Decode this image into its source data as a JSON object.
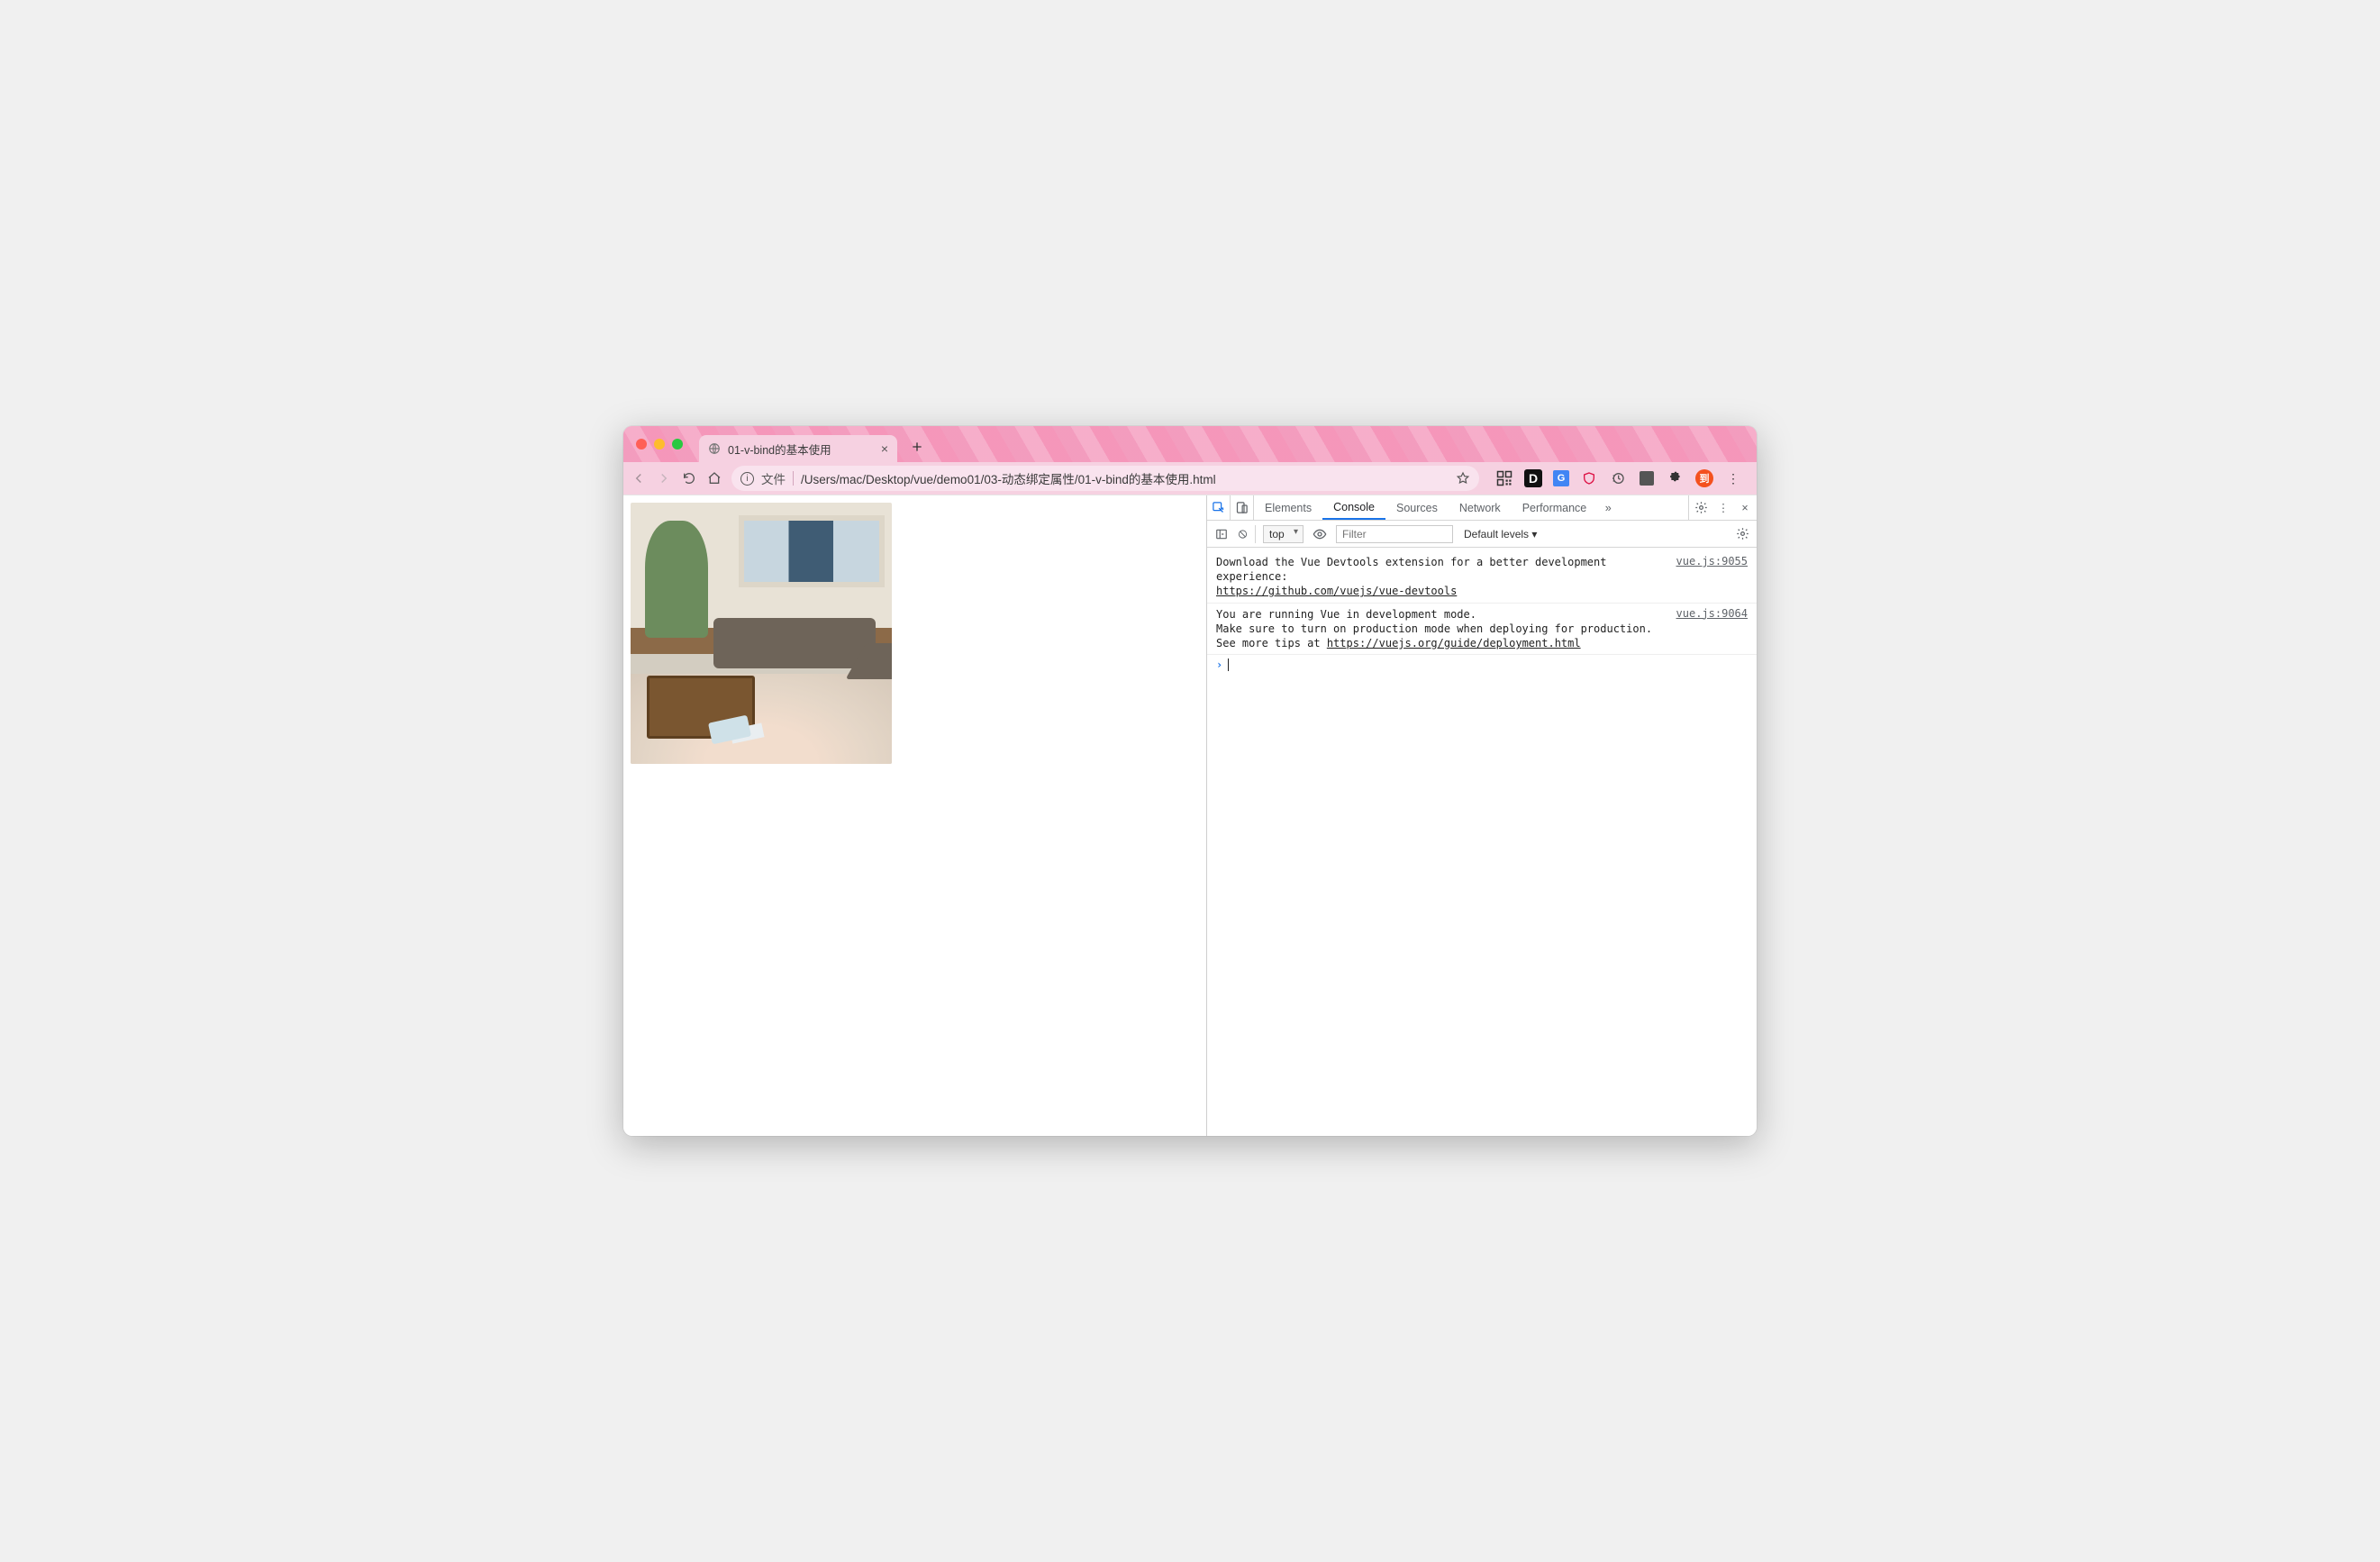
{
  "tab": {
    "title": "01-v-bind的基本使用"
  },
  "url": {
    "scheme_label": "文件",
    "path": "/Users/mac/Desktop/vue/demo01/03-动态绑定属性/01-v-bind的基本使用.html"
  },
  "extensions": {
    "qr_label": "QR",
    "vd_label": "D",
    "translate_label": "G",
    "avatar_label": "到"
  },
  "devtools": {
    "tabs": {
      "elements": "Elements",
      "console": "Console",
      "sources": "Sources",
      "network": "Network",
      "performance": "Performance"
    },
    "toolbar": {
      "context": "top",
      "filter_placeholder": "Filter",
      "levels": "Default levels ▾"
    },
    "logs": [
      {
        "text": "Download the Vue Devtools extension for a better development experience:\n",
        "link": "https://github.com/vuejs/vue-devtools",
        "src": "vue.js:9055"
      },
      {
        "text": "You are running Vue in development mode.\nMake sure to turn on production mode when deploying for production.\nSee more tips at ",
        "link": "https://vuejs.org/guide/deployment.html",
        "src": "vue.js:9064"
      }
    ]
  }
}
